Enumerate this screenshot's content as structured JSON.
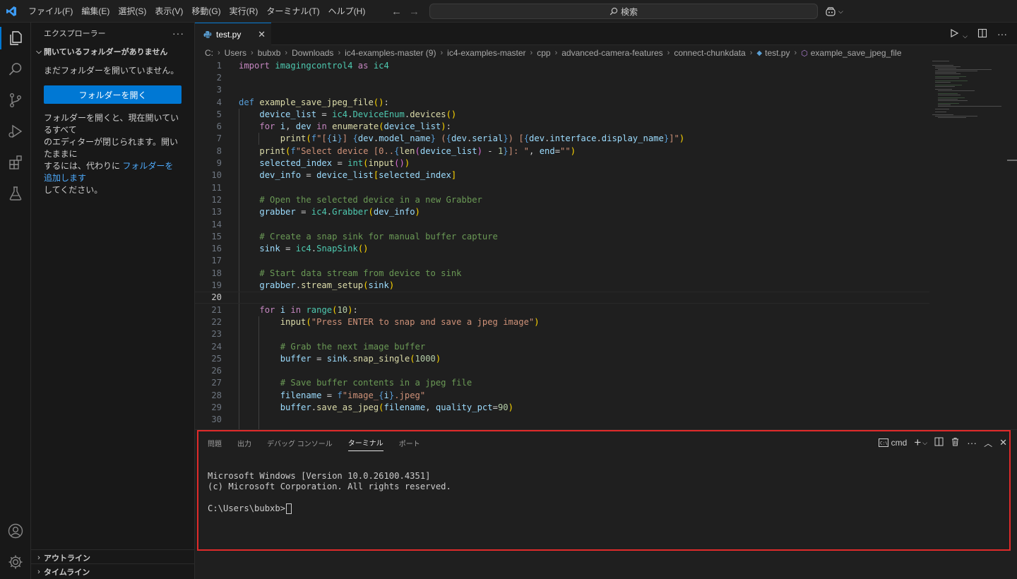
{
  "titlebar": {
    "menu": [
      "ファイル(F)",
      "編集(E)",
      "選択(S)",
      "表示(V)",
      "移動(G)",
      "実行(R)",
      "ターミナル(T)",
      "ヘルプ(H)"
    ],
    "search_placeholder": "検索"
  },
  "sidebar": {
    "title": "エクスプローラー",
    "section": "開いているフォルダーがありません",
    "no_folder_text": "まだフォルダーを開いていません。",
    "open_button": "フォルダーを開く",
    "info_line1": "フォルダーを開くと、現在開いているすべて",
    "info_line2": "のエディターが閉じられます。開いたままに",
    "info_line3_pre": "するには、代わりに ",
    "info_link": "フォルダーを追加します",
    "info_line4": "してください。",
    "outline": "アウトライン",
    "timeline": "タイムライン"
  },
  "editor": {
    "tab_label": "test.py",
    "breadcrumb": [
      "C:",
      "Users",
      "bubxb",
      "Downloads",
      "ic4-examples-master (9)",
      "ic4-examples-master",
      "cpp",
      "advanced-camera-features",
      "connect-chunkdata",
      "test.py",
      "example_save_jpeg_file"
    ],
    "line_numbers": [
      "1",
      "2",
      "3",
      "4",
      "5",
      "6",
      "7",
      "8",
      "9",
      "10",
      "11",
      "12",
      "13",
      "14",
      "15",
      "16",
      "17",
      "18",
      "19",
      "20",
      "21",
      "22",
      "23",
      "24",
      "25",
      "26",
      "27",
      "28",
      "29",
      "30"
    ],
    "current_line": "20"
  },
  "panel": {
    "tabs": [
      "問題",
      "出力",
      "デバッグ コンソール",
      "ターミナル",
      "ポート"
    ],
    "active_tab": "ターミナル",
    "shell": "cmd",
    "terminal_lines": [
      "Microsoft Windows [Version 10.0.26100.4351]",
      "(c) Microsoft Corporation. All rights reserved.",
      "",
      "C:\\Users\\bubxb>"
    ]
  },
  "colors": {
    "accent": "#0078d4",
    "highlight_box": "#e02a2a"
  }
}
